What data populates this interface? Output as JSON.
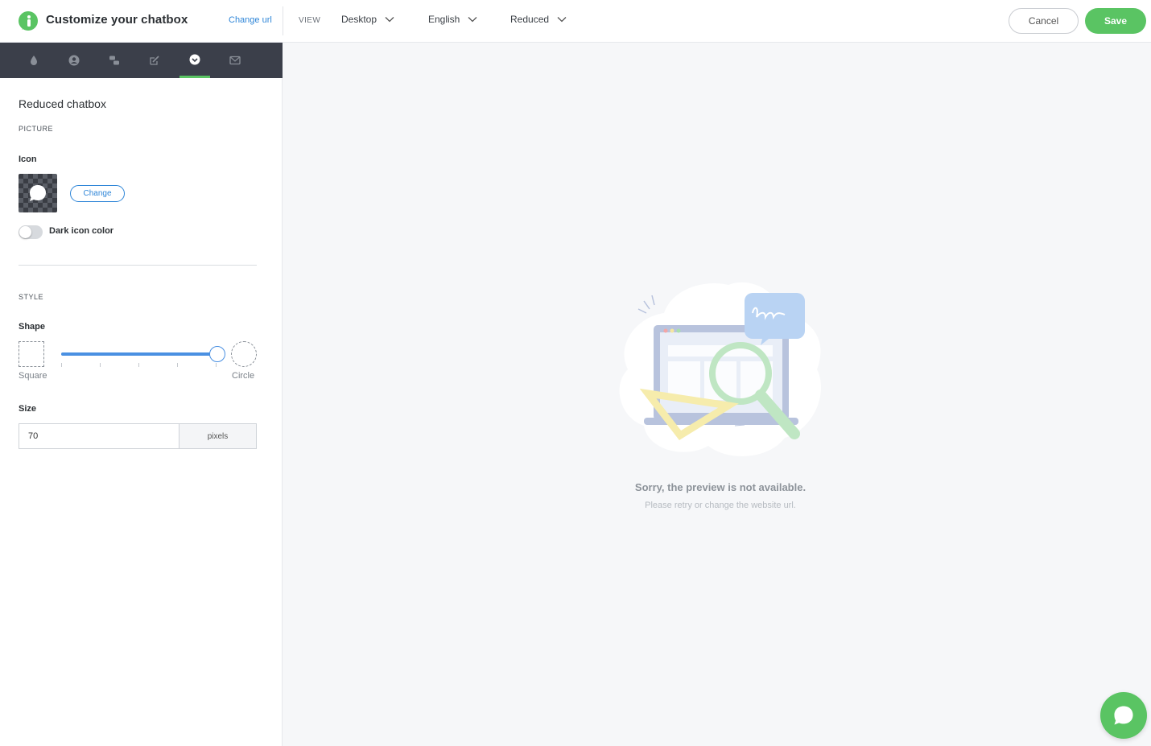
{
  "header": {
    "title": "Customize your chatbox",
    "change_url": "Change url",
    "view_label": "VIEW",
    "device": "Desktop",
    "language": "English",
    "mode": "Reduced",
    "cancel": "Cancel",
    "save": "Save"
  },
  "sidebar": {
    "tabs": [
      {
        "icon": "droplet-icon"
      },
      {
        "icon": "user-icon"
      },
      {
        "icon": "conversation-icon"
      },
      {
        "icon": "edit-icon"
      },
      {
        "icon": "chevron-circle-icon",
        "active": true
      },
      {
        "icon": "mail-icon"
      }
    ],
    "title": "Reduced chatbox",
    "picture_section": "PICTURE",
    "icon_label": "Icon",
    "change_button": "Change",
    "dark_toggle_label": "Dark icon color",
    "dark_toggle_on": false,
    "style_section": "STYLE",
    "shape_label": "Shape",
    "shape_min": "Square",
    "shape_max": "Circle",
    "shape_value": 1.0,
    "size_label": "Size",
    "size_value": "70",
    "size_unit": "pixels"
  },
  "preview": {
    "message": "Sorry, the preview is not available.",
    "sub": "Please retry or change the website url."
  },
  "colors": {
    "accent": "#5ac463",
    "link": "#2f86d8",
    "slider": "#4a90e2",
    "tabbar": "#3b3f4a"
  }
}
